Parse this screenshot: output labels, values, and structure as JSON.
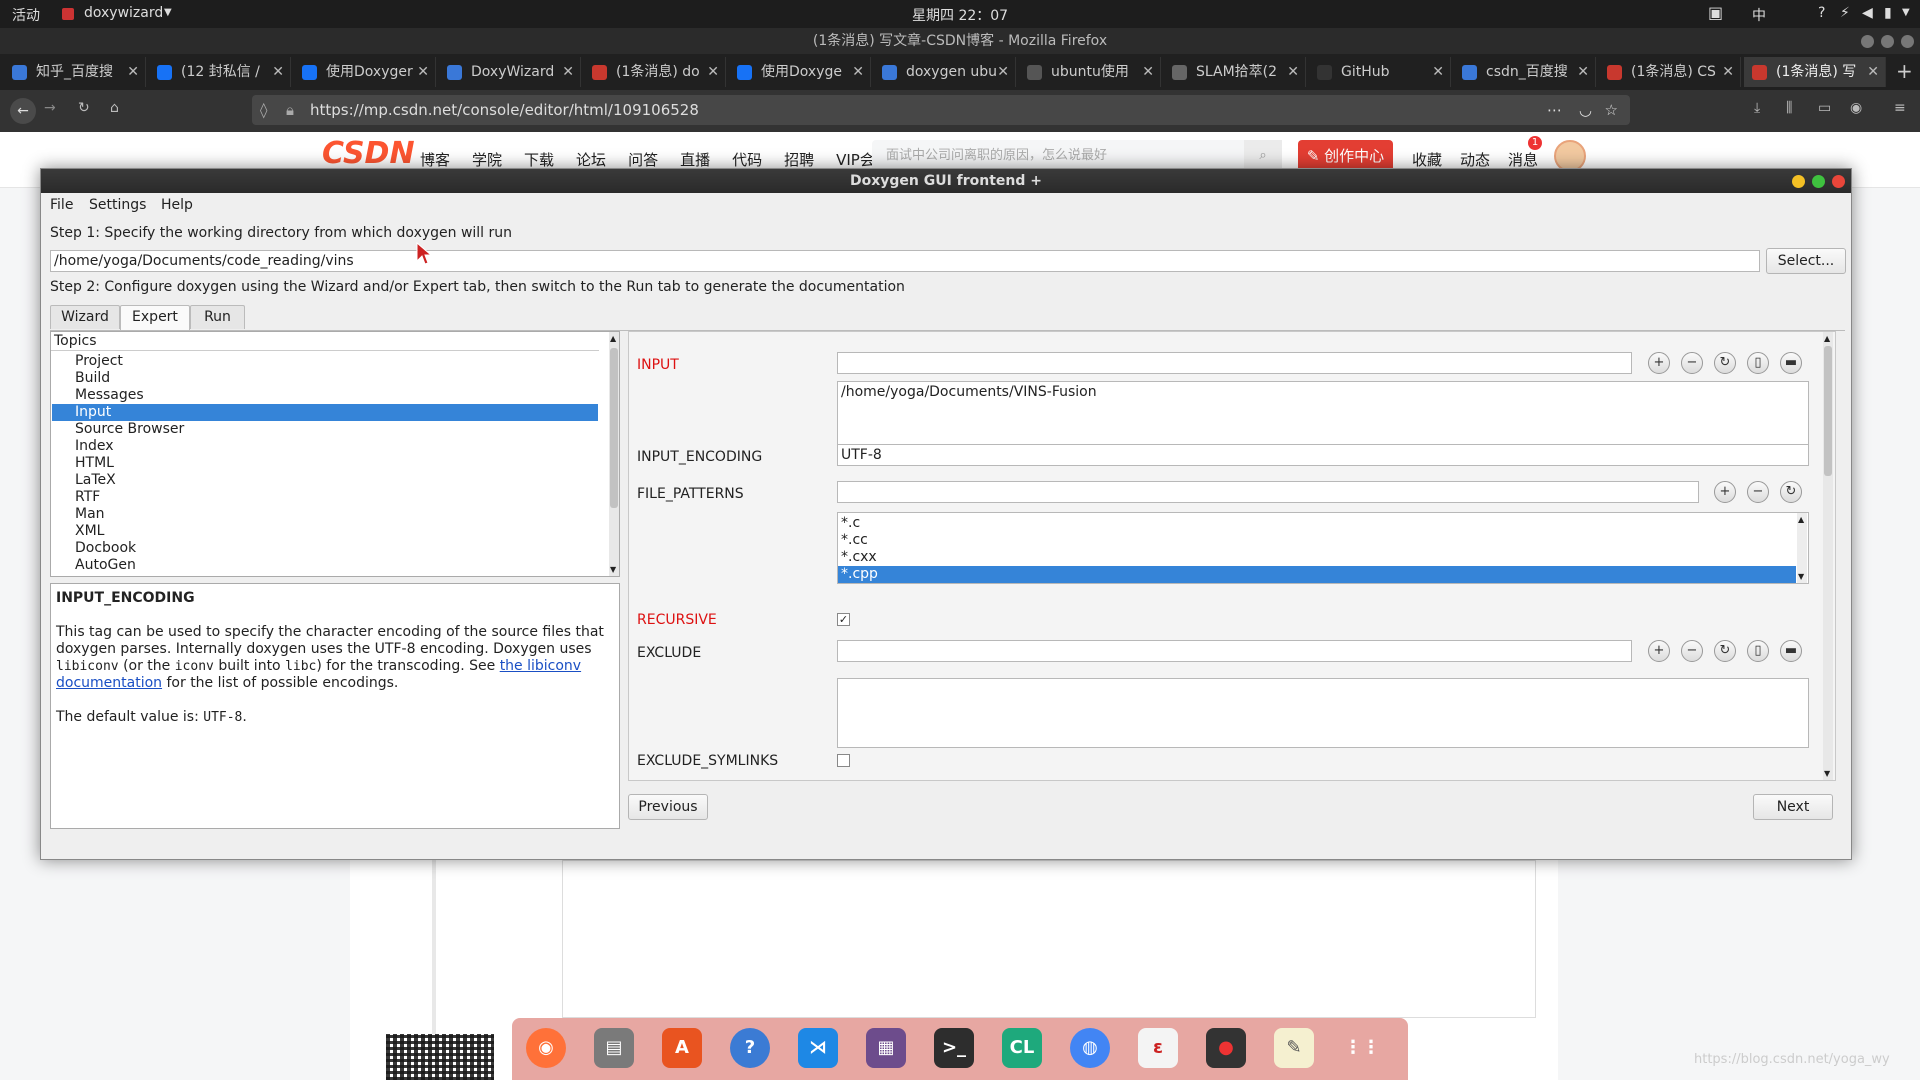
{
  "topbar": {
    "activities": "活动",
    "app_name": "doxywizard",
    "clock": "星期四 22：07",
    "input_method": "中"
  },
  "firefox": {
    "window_title": "(1条消息) 写文章-CSDN博客 - Mozilla Firefox",
    "tabs": [
      {
        "label": "知乎_百度搜",
        "color": "#3a78d8"
      },
      {
        "label": "(12 封私信 /",
        "color": "#1772f6"
      },
      {
        "label": "使用Doxyger",
        "color": "#1772f6"
      },
      {
        "label": "DoxyWizard",
        "color": "#3a78d8"
      },
      {
        "label": "(1条消息) do",
        "color": "#c8382e"
      },
      {
        "label": "使用Doxyge",
        "color": "#1772f6"
      },
      {
        "label": "doxygen ubu",
        "color": "#3a78d8"
      },
      {
        "label": "ubuntu使用",
        "color": "#555"
      },
      {
        "label": "SLAM拾萃(2",
        "color": "#666"
      },
      {
        "label": "GitHub",
        "color": "#333"
      },
      {
        "label": "csdn_百度搜",
        "color": "#3a78d8"
      },
      {
        "label": "(1条消息) CS",
        "color": "#c8382e"
      },
      {
        "label": "(1条消息) 写",
        "color": "#c8382e"
      }
    ],
    "url": "https://mp.csdn.net/console/editor/html/109106528"
  },
  "csdn": {
    "logo": "CSDN",
    "nav": [
      "博客",
      "学院",
      "下载",
      "论坛",
      "问答",
      "直播",
      "代码",
      "招聘",
      "VIP会员"
    ],
    "search_placeholder": "面试中公司问离职的原因，怎么说最好",
    "create_button": "创作中心",
    "links": [
      "收藏",
      "动态",
      "消息"
    ],
    "message_badge": "1",
    "watermark": "https://blog.csdn.net/yoga_wy"
  },
  "doxygen": {
    "title": "Doxygen GUI frontend +",
    "menu": [
      "File",
      "Settings",
      "Help"
    ],
    "step1": "Step 1: Specify the working directory from which doxygen will run",
    "workdir": "/home/yoga/Documents/code_reading/vins",
    "select_button": "Select...",
    "step2": "Step 2: Configure doxygen using the Wizard and/or Expert tab, then switch to the Run tab to generate the documentation",
    "tabs": [
      "Wizard",
      "Expert",
      "Run"
    ],
    "topics_header": "Topics",
    "topics": [
      "Project",
      "Build",
      "Messages",
      "Input",
      "Source Browser",
      "Index",
      "HTML",
      "LaTeX",
      "RTF",
      "Man",
      "XML",
      "Docbook",
      "AutoGen"
    ],
    "selected_topic": "Input",
    "help": {
      "title": "INPUT_ENCODING",
      "p1a": "This tag can be used to specify the character encoding of the source files that doxygen parses. Internally doxygen uses the UTF-8 encoding. Doxygen uses ",
      "code1": "libiconv",
      "p1b": " (or the ",
      "code2": "iconv",
      "p1c": " built into ",
      "code3": "libc",
      "p1d": ") for the transcoding. See ",
      "link": "the libiconv documentation",
      "p1e": " for the list of possible encodings.",
      "default_prefix": "The default value is: ",
      "default_value": "UTF-8",
      "default_suffix": "."
    },
    "fields": {
      "input_label": "INPUT",
      "input_value": "",
      "input_list": [
        "/home/yoga/Documents/VINS-Fusion"
      ],
      "encoding_label": "INPUT_ENCODING",
      "encoding_value": "UTF-8",
      "patterns_label": "FILE_PATTERNS",
      "patterns_value": "",
      "patterns_list": [
        "*.c",
        "*.cc",
        "*.cxx",
        "*.cpp"
      ],
      "patterns_selected": "*.cpp",
      "recursive_label": "RECURSIVE",
      "recursive_checked": true,
      "exclude_label": "EXCLUDE",
      "exclude_value": "",
      "exclude_symlinks_label": "EXCLUDE_SYMLINKS",
      "exclude_symlinks_checked": false
    },
    "previous_button": "Previous",
    "next_button": "Next"
  }
}
